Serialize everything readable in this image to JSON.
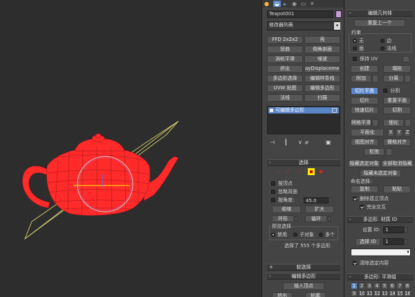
{
  "top_tabs": [
    "create-tab",
    "modify-tab",
    "hierarchy-tab",
    "motion-tab",
    "display-tab",
    "utilities-tab"
  ],
  "object": {
    "name": "Teapot001",
    "color": "#c79ad8"
  },
  "modifier_list": {
    "label": "修改器列表"
  },
  "modifier_buttons": [
    "FFD 2x2x2",
    "壳",
    "扭曲",
    "倒角剖面",
    "涡轮平滑",
    "噪波",
    "挤出",
    "ayDisplacementM",
    "多边形选择",
    "编辑样条线",
    "UVW 贴图",
    "编辑多边形",
    "法线",
    "扫描"
  ],
  "stack": {
    "item": "可编辑多边形"
  },
  "selection": {
    "title": "选择",
    "by_vertex": "按顶点",
    "ignore_backface": "忽略背面",
    "by_angle": "按角度:",
    "angle_value": "45.0",
    "shrink": "收缩",
    "grow": "扩大",
    "ring": "环形",
    "loop": "循环",
    "preview_title": "预览选择",
    "preview_options": [
      "禁用",
      "子对象",
      "多个"
    ],
    "status": "选择了 555 个多边形"
  },
  "soft_selection": {
    "title": "软选择"
  },
  "edit_polygons": {
    "title": "编辑多边形",
    "insert_vertex": "插入顶点",
    "extrude": "挤出",
    "outline": "轮廓"
  },
  "edit_geometry": {
    "title": "编辑几何体",
    "repeat_last": "重复上一个",
    "constraints_title": "约束",
    "constraints": [
      "无",
      "边",
      "面",
      "法线"
    ],
    "preserve_uvs": "保持 UV",
    "create": "创建",
    "collapse": "塌陷",
    "attach": "附加",
    "detach": "分离",
    "slice_plane": "切片平面",
    "split": "分割",
    "slice": "切片",
    "reset_plane": "重置平面",
    "quickslice": "快速切片",
    "cut": "切割",
    "meshsmooth": "网格平滑",
    "tessellate": "细化",
    "make_planar": "平面化",
    "axis_x": "X",
    "axis_y": "Y",
    "axis_z": "Z",
    "view_align": "视图对齐",
    "grid_align": "栅格对齐",
    "relax": "松弛",
    "hide_selected": "隐藏选定对象",
    "unhide_all": "全部取消隐藏",
    "hide_unselected": "隐藏未选定对象",
    "named_sel_label": "命名选择:",
    "copy": "复制",
    "paste": "粘贴",
    "delete_isolated": "删除孤立顶点",
    "full_interactivity": "完全交互"
  },
  "polygon_material_ids": {
    "title": "多边形: 材质 ID",
    "set_id_label": "设置 ID:",
    "set_id_value": "1",
    "select_id_label": "选择 ID",
    "select_id_value": "1",
    "clear_selection": "清除选定内容"
  },
  "smoothing_groups": {
    "title": "多边形: 平滑组",
    "row1": [
      "1",
      "2",
      "3",
      "4",
      "5",
      "6",
      "7",
      "8"
    ],
    "row2": [
      "9",
      "10",
      "11",
      "12",
      "13",
      "14",
      "15",
      "16"
    ]
  },
  "colors": {
    "accent_blue": "#5a86c9",
    "teapot_red": "#ff2222",
    "highlight_yellow": "#ffee00"
  }
}
